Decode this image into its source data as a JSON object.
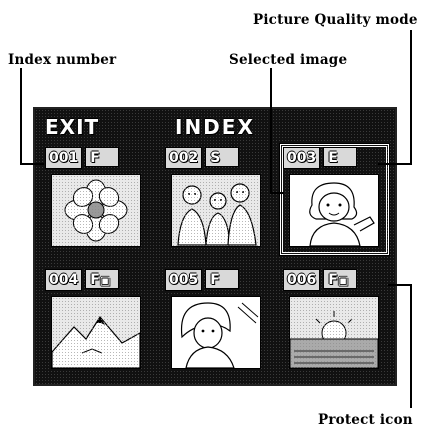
{
  "callouts": {
    "picture_quality_mode": "Picture Quality mode",
    "index_number": "Index number",
    "selected_image": "Selected image",
    "protect_icon": "Protect icon"
  },
  "screen": {
    "exit": "EXIT",
    "title": "INDEX",
    "cells": [
      {
        "number": "001",
        "quality": "F",
        "protected": false,
        "thumbnail": "flower-icon"
      },
      {
        "number": "002",
        "quality": "S",
        "protected": false,
        "thumbnail": "people-icon"
      },
      {
        "number": "003",
        "quality": "E",
        "protected": false,
        "thumbnail": "girl-icon",
        "selected": true
      },
      {
        "number": "004",
        "quality": "F",
        "protected": true,
        "thumbnail": "mountain-icon"
      },
      {
        "number": "005",
        "quality": "F",
        "protected": false,
        "thumbnail": "woman-icon"
      },
      {
        "number": "006",
        "quality": "F",
        "protected": true,
        "thumbnail": "sunset-icon"
      }
    ]
  }
}
